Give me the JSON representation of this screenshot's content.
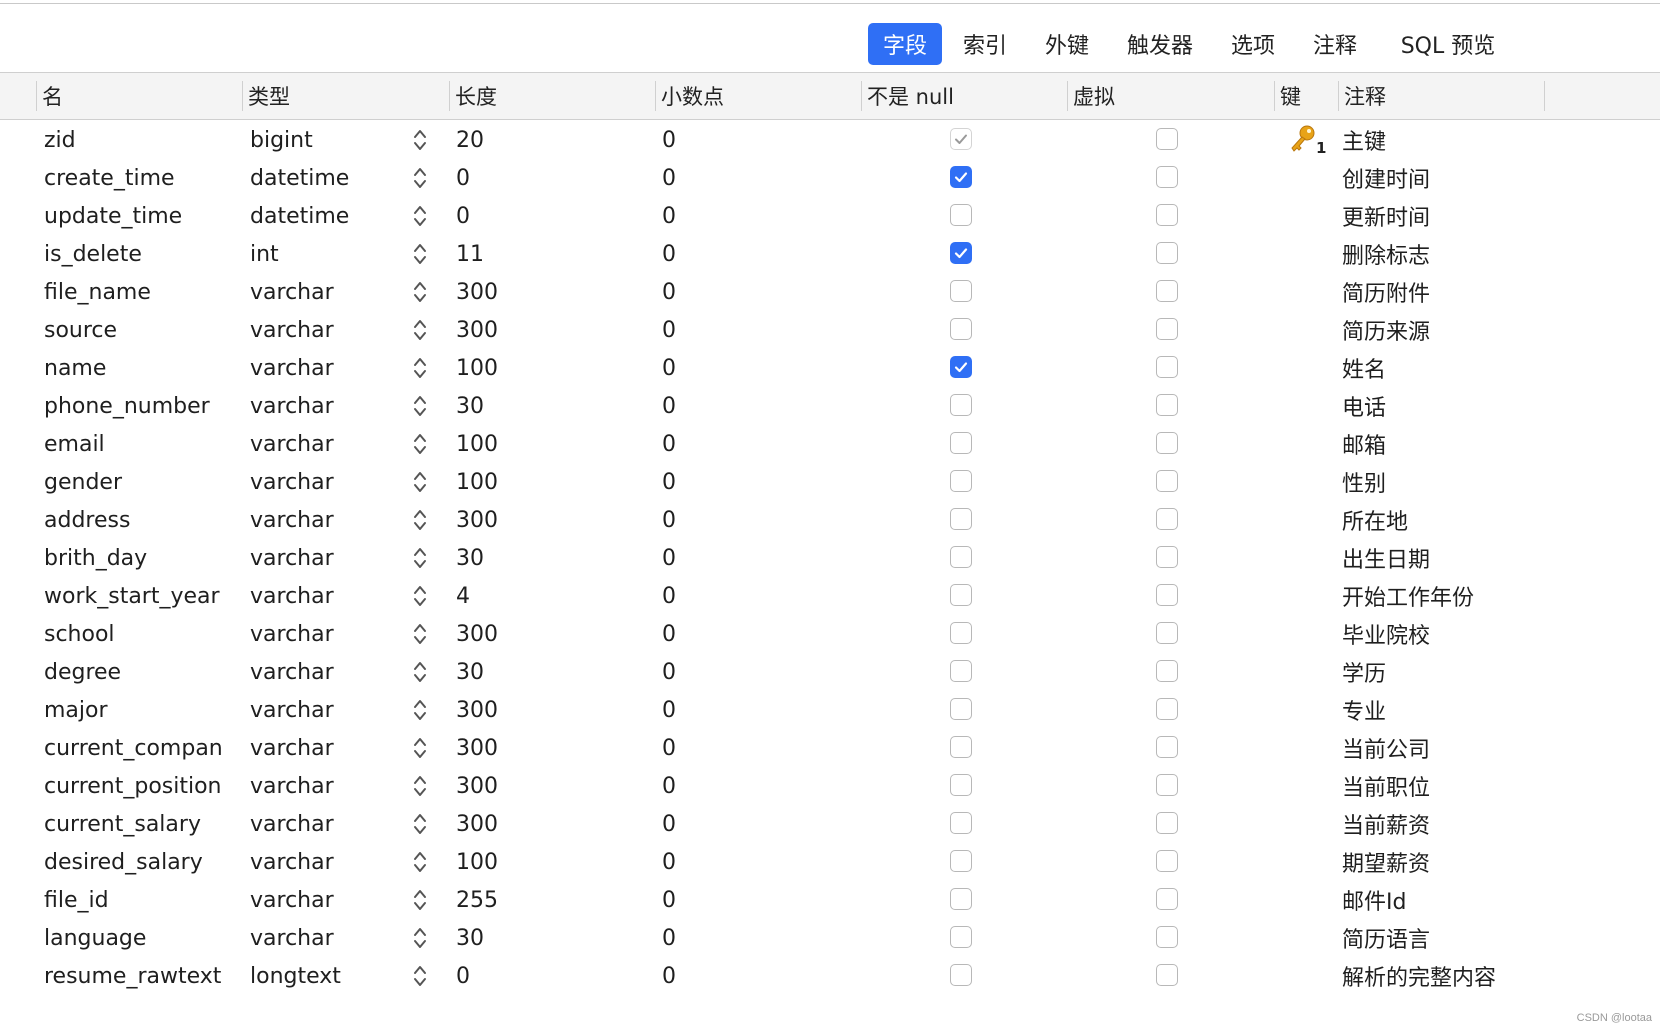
{
  "tabs": [
    {
      "label": "字段",
      "active": true
    },
    {
      "label": "索引",
      "active": false
    },
    {
      "label": "外键",
      "active": false
    },
    {
      "label": "触发器",
      "active": false
    },
    {
      "label": "选项",
      "active": false
    },
    {
      "label": "注释",
      "active": false
    },
    {
      "label": "SQL 预览",
      "active": false
    }
  ],
  "columns": {
    "name": "名",
    "type": "类型",
    "length": "长度",
    "decimals": "小数点",
    "not_null": "不是 null",
    "virtual": "虚拟",
    "key": "键",
    "comment": "注释"
  },
  "rows": [
    {
      "name": "zid",
      "type": "bigint",
      "length": "20",
      "decimals": "0",
      "not_null": true,
      "not_null_disabled": true,
      "virtual": false,
      "key": "1",
      "comment": "主键"
    },
    {
      "name": "create_time",
      "type": "datetime",
      "length": "0",
      "decimals": "0",
      "not_null": true,
      "virtual": false,
      "key": "",
      "comment": "创建时间"
    },
    {
      "name": "update_time",
      "type": "datetime",
      "length": "0",
      "decimals": "0",
      "not_null": false,
      "virtual": false,
      "key": "",
      "comment": "更新时间"
    },
    {
      "name": "is_delete",
      "type": "int",
      "length": "11",
      "decimals": "0",
      "not_null": true,
      "virtual": false,
      "key": "",
      "comment": "删除标志"
    },
    {
      "name": "file_name",
      "type": "varchar",
      "length": "300",
      "decimals": "0",
      "not_null": false,
      "virtual": false,
      "key": "",
      "comment": "简历附件"
    },
    {
      "name": "source",
      "type": "varchar",
      "length": "300",
      "decimals": "0",
      "not_null": false,
      "virtual": false,
      "key": "",
      "comment": "简历来源"
    },
    {
      "name": "name",
      "type": "varchar",
      "length": "100",
      "decimals": "0",
      "not_null": true,
      "virtual": false,
      "key": "",
      "comment": "姓名"
    },
    {
      "name": "phone_number",
      "type": "varchar",
      "length": "30",
      "decimals": "0",
      "not_null": false,
      "virtual": false,
      "key": "",
      "comment": "电话"
    },
    {
      "name": "email",
      "type": "varchar",
      "length": "100",
      "decimals": "0",
      "not_null": false,
      "virtual": false,
      "key": "",
      "comment": "邮箱"
    },
    {
      "name": "gender",
      "type": "varchar",
      "length": "100",
      "decimals": "0",
      "not_null": false,
      "virtual": false,
      "key": "",
      "comment": "性别"
    },
    {
      "name": "address",
      "type": "varchar",
      "length": "300",
      "decimals": "0",
      "not_null": false,
      "virtual": false,
      "key": "",
      "comment": "所在地"
    },
    {
      "name": "brith_day",
      "type": "varchar",
      "length": "30",
      "decimals": "0",
      "not_null": false,
      "virtual": false,
      "key": "",
      "comment": "出生日期"
    },
    {
      "name": "work_start_year",
      "type": "varchar",
      "length": "4",
      "decimals": "0",
      "not_null": false,
      "virtual": false,
      "key": "",
      "comment": "开始工作年份"
    },
    {
      "name": "school",
      "type": "varchar",
      "length": "300",
      "decimals": "0",
      "not_null": false,
      "virtual": false,
      "key": "",
      "comment": "毕业院校"
    },
    {
      "name": "degree",
      "type": "varchar",
      "length": "30",
      "decimals": "0",
      "not_null": false,
      "virtual": false,
      "key": "",
      "comment": "学历"
    },
    {
      "name": "major",
      "type": "varchar",
      "length": "300",
      "decimals": "0",
      "not_null": false,
      "virtual": false,
      "key": "",
      "comment": "专业"
    },
    {
      "name": "current_compan",
      "type": "varchar",
      "length": "300",
      "decimals": "0",
      "not_null": false,
      "virtual": false,
      "key": "",
      "comment": "当前公司"
    },
    {
      "name": "current_position",
      "type": "varchar",
      "length": "300",
      "decimals": "0",
      "not_null": false,
      "virtual": false,
      "key": "",
      "comment": "当前职位"
    },
    {
      "name": "current_salary",
      "type": "varchar",
      "length": "300",
      "decimals": "0",
      "not_null": false,
      "virtual": false,
      "key": "",
      "comment": "当前薪资"
    },
    {
      "name": "desired_salary",
      "type": "varchar",
      "length": "100",
      "decimals": "0",
      "not_null": false,
      "virtual": false,
      "key": "",
      "comment": "期望薪资"
    },
    {
      "name": "file_id",
      "type": "varchar",
      "length": "255",
      "decimals": "0",
      "not_null": false,
      "virtual": false,
      "key": "",
      "comment": "邮件Id"
    },
    {
      "name": "language",
      "type": "varchar",
      "length": "30",
      "decimals": "0",
      "not_null": false,
      "virtual": false,
      "key": "",
      "comment": "简历语言"
    },
    {
      "name": "resume_rawtext",
      "type": "longtext",
      "length": "0",
      "decimals": "0",
      "not_null": false,
      "virtual": false,
      "key": "",
      "comment": "解析的完整内容"
    }
  ],
  "icons": {
    "stepper": "updown-chevron-icon",
    "key": "primary-key-icon",
    "checkbox": "checkbox"
  },
  "colors": {
    "accent": "#2f6ff5",
    "key": "#e8a317"
  },
  "watermark": "CSDN @lootaa"
}
